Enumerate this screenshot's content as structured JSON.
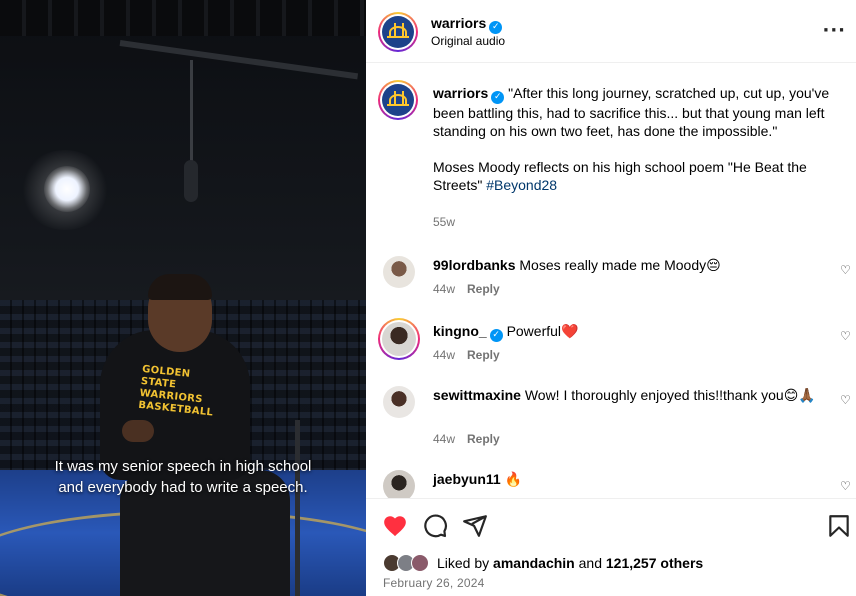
{
  "video": {
    "caption_line1": "It was my senior speech in high school",
    "caption_line2": "and everybody had to write a speech.",
    "shirt_text": "GOLDEN STATE WARRIORS BASKETBALL"
  },
  "header": {
    "username": "warriors",
    "subtitle": "Original audio",
    "more_icon": "more-horizontal-icon"
  },
  "caption": {
    "username": "warriors",
    "text_part1": "\"After this long journey, scratched up, cut up, you've been battling this, had to sacrifice this... but that young man left standing on his own two feet, has done the impossible.\"",
    "text_part2": "Moses Moody reflects on his high school poem \"He Beat the Streets\"",
    "hashtag": "#Beyond28",
    "time": "55w"
  },
  "comments": [
    {
      "username": "99lordbanks",
      "text": "Moses really made me Moody😔",
      "time": "44w",
      "reply": "Reply"
    },
    {
      "username": "kingno_",
      "text": "Powerful❤️",
      "time": "44w",
      "reply": "Reply"
    },
    {
      "username": "sewittmaxine",
      "text": "Wow! I thoroughly enjoyed this!!thank you😊🙏🏾",
      "time": "44w",
      "reply": "Reply"
    },
    {
      "username": "jaebyun11",
      "text": "🔥"
    }
  ],
  "actions": {
    "like_icon": "heart-filled-icon",
    "comment_icon": "comment-icon",
    "share_icon": "paper-plane-icon",
    "save_icon": "bookmark-icon"
  },
  "likes": {
    "prefix": "Liked by",
    "user": "amandachin",
    "and": "and",
    "count": "121,257 others"
  },
  "date": "February 26, 2024",
  "colors": {
    "like_red": "#ff3040",
    "verified_blue": "#0095f6",
    "hashtag": "#00376b",
    "muted": "#737373",
    "warriors_blue": "#1d428a",
    "warriors_gold": "#ffc72c"
  }
}
